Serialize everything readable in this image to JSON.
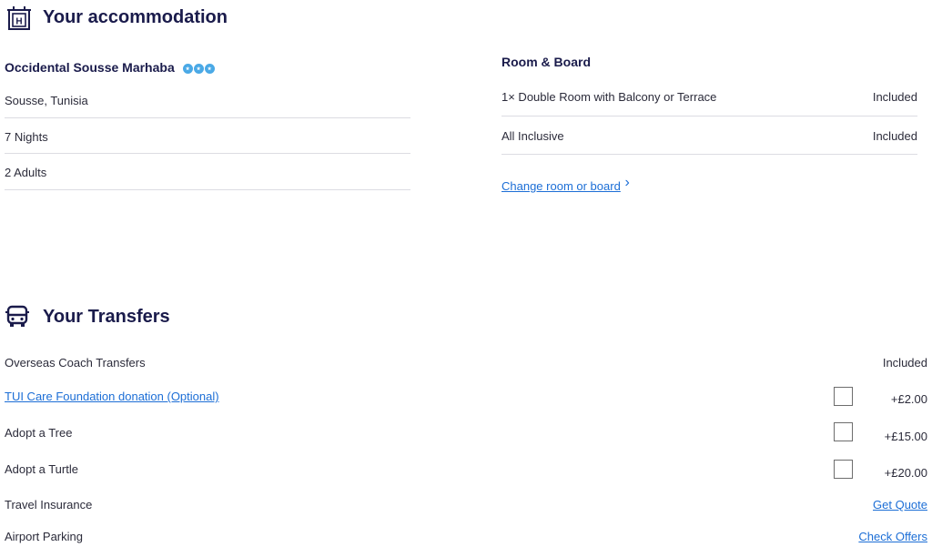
{
  "accommodation": {
    "title": "Your accommodation",
    "hotel_name": "Occidental Sousse Marhaba",
    "rating_stars": 3,
    "rows": [
      "Sousse, Tunisia",
      "7 Nights",
      "2  Adults"
    ]
  },
  "room_board": {
    "title": "Room & Board",
    "rows": [
      {
        "label": "1× Double Room with Balcony or Terrace",
        "value": "Included"
      },
      {
        "label": "All Inclusive",
        "value": "Included"
      }
    ],
    "change_link": "Change room or board",
    "chevron": "›"
  },
  "transfers": {
    "title": "Your Transfers",
    "overseas": {
      "label": "Overseas Coach Transfers",
      "value": "Included"
    },
    "extras": [
      {
        "label": "TUI Care Foundation donation (Optional)",
        "price": "+£2.00",
        "checked": false
      },
      {
        "label": "Adopt a Tree",
        "price": "+£15.00",
        "checked": false
      },
      {
        "label": "Adopt a Turtle",
        "price": "+£20.00",
        "checked": false
      }
    ],
    "insurance": {
      "label": "Travel Insurance",
      "action": "Get Quote"
    },
    "parking": {
      "label": "Airport Parking",
      "action": "Check Offers"
    }
  },
  "colors": {
    "heading": "#1a1b4b",
    "link": "#1c6ed6",
    "star": "#4aa9e6"
  },
  "icons": {
    "hotel": "hotel-icon",
    "bus": "bus-icon",
    "star": "star-icon",
    "chevron": "chevron-right-icon"
  }
}
